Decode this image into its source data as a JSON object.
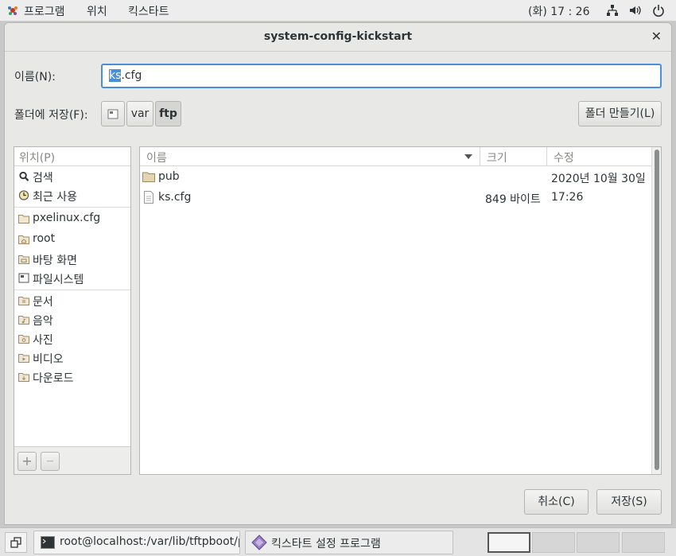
{
  "toppanel": {
    "apps": "프로그램",
    "places": "위치",
    "kickstart": "킥스타트",
    "clock": "(화) 17 : 26"
  },
  "dialog": {
    "title": "system-config-kickstart",
    "name_label": "이름(N):",
    "name_selected": "ks",
    "name_rest": ".cfg",
    "folder_label": "폴더에 저장(F):",
    "path": [
      "var",
      "ftp"
    ],
    "create_folder": "폴더 만들기(L)",
    "cancel": "취소(C)",
    "save": "저장(S)"
  },
  "places": {
    "header": "위치(P)",
    "items": [
      "검색",
      "최근 사용",
      "pxelinux.cfg",
      "root",
      "바탕 화면",
      "파일시스템",
      "문서",
      "음악",
      "사진",
      "비디오",
      "다운로드"
    ],
    "add": "+",
    "remove": "—"
  },
  "files": {
    "columns": {
      "name": "이름",
      "size": "크기",
      "modified": "수정"
    },
    "rows": [
      {
        "name": "pub",
        "size": "",
        "modified": "2020년 10월 30일",
        "type": "folder"
      },
      {
        "name": "ks.cfg",
        "size": "849 바이트",
        "modified": "17:26",
        "type": "file"
      }
    ]
  },
  "taskbar": {
    "terminal": "root@localhost:/var/lib/tftpboot/px…",
    "kickstart_app": "킥스타트 설정 프로그램"
  },
  "colors": {
    "accent": "#4a90d9",
    "folder": "#c9b38a"
  },
  "icons": [
    "apps-icon",
    "network-icon",
    "volume-icon",
    "power-icon",
    "close-icon",
    "drive-icon",
    "search-icon",
    "recent-icon",
    "folder-icon",
    "file-icon",
    "terminal-icon",
    "kickstart-icon",
    "show-desktop-icon"
  ]
}
